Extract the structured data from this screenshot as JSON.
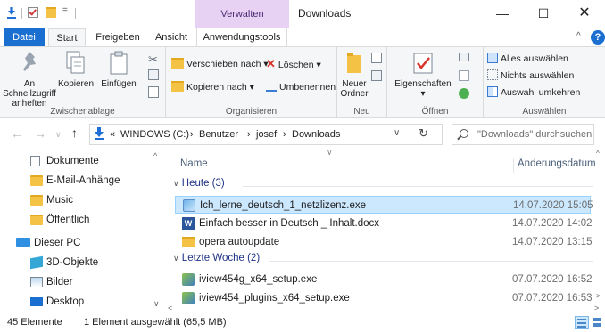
{
  "window": {
    "title": "Downloads",
    "contextual_tab_group": "Verwalten",
    "minimize": "—",
    "maximize": "☐",
    "close": "✕"
  },
  "quick_access_toolbar": {
    "dropdown": "="
  },
  "ribbon_tabs": [
    "Datei",
    "Start",
    "Freigeben",
    "Ansicht",
    "Anwendungstools"
  ],
  "ribbon_active_tab": "Start",
  "ribbon": {
    "zwischenablage": {
      "label": "Zwischenablage",
      "pin_line1": "An Schnellzugriff",
      "pin_line2": "anheften",
      "copy": "Kopieren",
      "paste": "Einfügen"
    },
    "organisieren": {
      "label": "Organisieren",
      "move_to": "Verschieben nach",
      "copy_to": "Kopieren nach",
      "delete": "Löschen",
      "rename": "Umbenennen"
    },
    "neu": {
      "label": "Neu",
      "new_folder_line1": "Neuer",
      "new_folder_line2": "Ordner"
    },
    "oeffnen": {
      "label": "Öffnen",
      "properties": "Eigenschaften"
    },
    "auswaehlen": {
      "label": "Auswählen",
      "select_all": "Alles auswählen",
      "select_none": "Nichts auswählen",
      "invert": "Auswahl umkehren"
    }
  },
  "address": {
    "prefix": "«",
    "crumbs": [
      "WINDOWS (C:)",
      "Benutzer",
      "josef",
      "Downloads"
    ],
    "separator": "›"
  },
  "search": {
    "placeholder": "\"Downloads\" durchsuchen"
  },
  "nav_pane": {
    "items": [
      {
        "label": "Dokumente",
        "icon": "documents-icon"
      },
      {
        "label": "E-Mail-Anhänge",
        "icon": "folder-icon"
      },
      {
        "label": "Music",
        "icon": "folder-icon"
      },
      {
        "label": "Öffentlich",
        "icon": "folder-icon"
      },
      {
        "label": "Dieser PC",
        "icon": "this-pc-icon"
      },
      {
        "label": "3D-Objekte",
        "icon": "3d-objects-icon"
      },
      {
        "label": "Bilder",
        "icon": "pictures-icon"
      },
      {
        "label": "Desktop",
        "icon": "desktop-icon"
      }
    ]
  },
  "file_list": {
    "columns": {
      "name": "Name",
      "date": "Änderungsdatum"
    },
    "groups": [
      {
        "title": "Heute (3)",
        "files": [
          {
            "name": "Ich_lerne_deutsch_1_netzlizenz.exe",
            "date": "14.07.2020 15:05",
            "icon": "installer-icon",
            "selected": true
          },
          {
            "name": "Einfach besser in Deutsch _ Inhalt.docx",
            "date": "14.07.2020 14:02",
            "icon": "word-doc-icon",
            "selected": false
          },
          {
            "name": "opera autoupdate",
            "date": "14.07.2020 13:15",
            "icon": "folder-icon",
            "selected": false
          }
        ]
      },
      {
        "title": "Letzte Woche (2)",
        "files": [
          {
            "name": "iview454g_x64_setup.exe",
            "date": "07.07.2020 16:52",
            "icon": "setup-exe-icon",
            "selected": false
          },
          {
            "name": "iview454_plugins_x64_setup.exe",
            "date": "07.07.2020 16:53",
            "icon": "setup-exe-icon",
            "selected": false
          }
        ]
      }
    ]
  },
  "status": {
    "count": "45 Elemente",
    "selection": "1 Element ausgewählt (65,5 MB)"
  },
  "colors": {
    "accent": "#1a6fd0",
    "verwalten_bg": "#e8d2f4",
    "selection_bg": "#cce8ff",
    "group_header": "#1e3287",
    "folder_yellow": "#f4c244"
  }
}
